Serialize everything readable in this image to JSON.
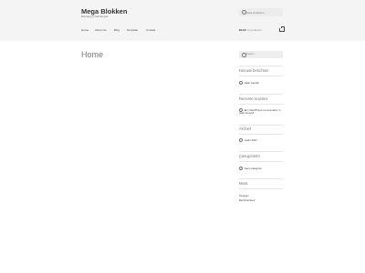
{
  "site": {
    "title": "Mega Blokken",
    "tagline": "Bezorging in heel Europa"
  },
  "header": {
    "search_placeholder": "Zoek producten..."
  },
  "nav": {
    "items": [
      "Home",
      "About Us",
      "Blog",
      "Template",
      "Contact"
    ]
  },
  "cart": {
    "amount": "€0,00",
    "count": "0 producten"
  },
  "main": {
    "page_title": "Home"
  },
  "sidebar": {
    "search_placeholder": "Zoeken...",
    "recent_posts_title": "Nieuwe berichten",
    "recent_posts": [
      "Hallo wereld!"
    ],
    "recent_comments_title": "Recente reacties",
    "recent_comments": [
      "Een WordPress-commentator in Hallo wereld!"
    ],
    "archives_title": "Archief",
    "archives": [
      "maart 2021"
    ],
    "categories_title": "Categorieën",
    "categories": [
      "Geen categorie"
    ],
    "meta_title": "Meta",
    "meta_items": [
      "Inloggen",
      "Berichtenfeed"
    ]
  }
}
